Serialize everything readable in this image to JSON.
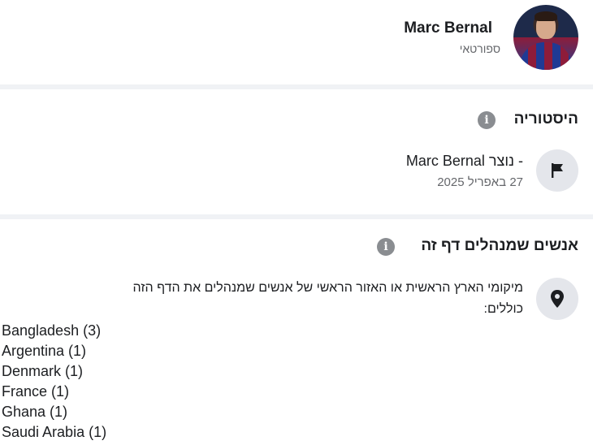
{
  "profile": {
    "name": "Marc Bernal",
    "category": "ספורטאי"
  },
  "history": {
    "title": "היסטוריה",
    "event_prefix": "נוצר -",
    "event_name": "Marc Bernal",
    "event_date": "27 באפריל 2025"
  },
  "managers": {
    "title": "אנשים שמנהלים דף זה",
    "description_line1": "מיקומי הארץ הראשית או האזור הראשי של אנשים שמנהלים את הדף הזה",
    "description_line2": "כוללים:",
    "countries": [
      "Bangladesh (3)",
      "Argentina (1)",
      "Denmark (1)",
      "France (1)",
      "Ghana (1)",
      "Saudi Arabia (1)"
    ]
  },
  "icons": {
    "info": "info-icon",
    "flag": "flag-icon",
    "location": "location-pin-icon"
  },
  "colors": {
    "separator": "#f0f2f5",
    "secondary_text": "#65676b",
    "icon_bg": "#e4e6eb"
  }
}
